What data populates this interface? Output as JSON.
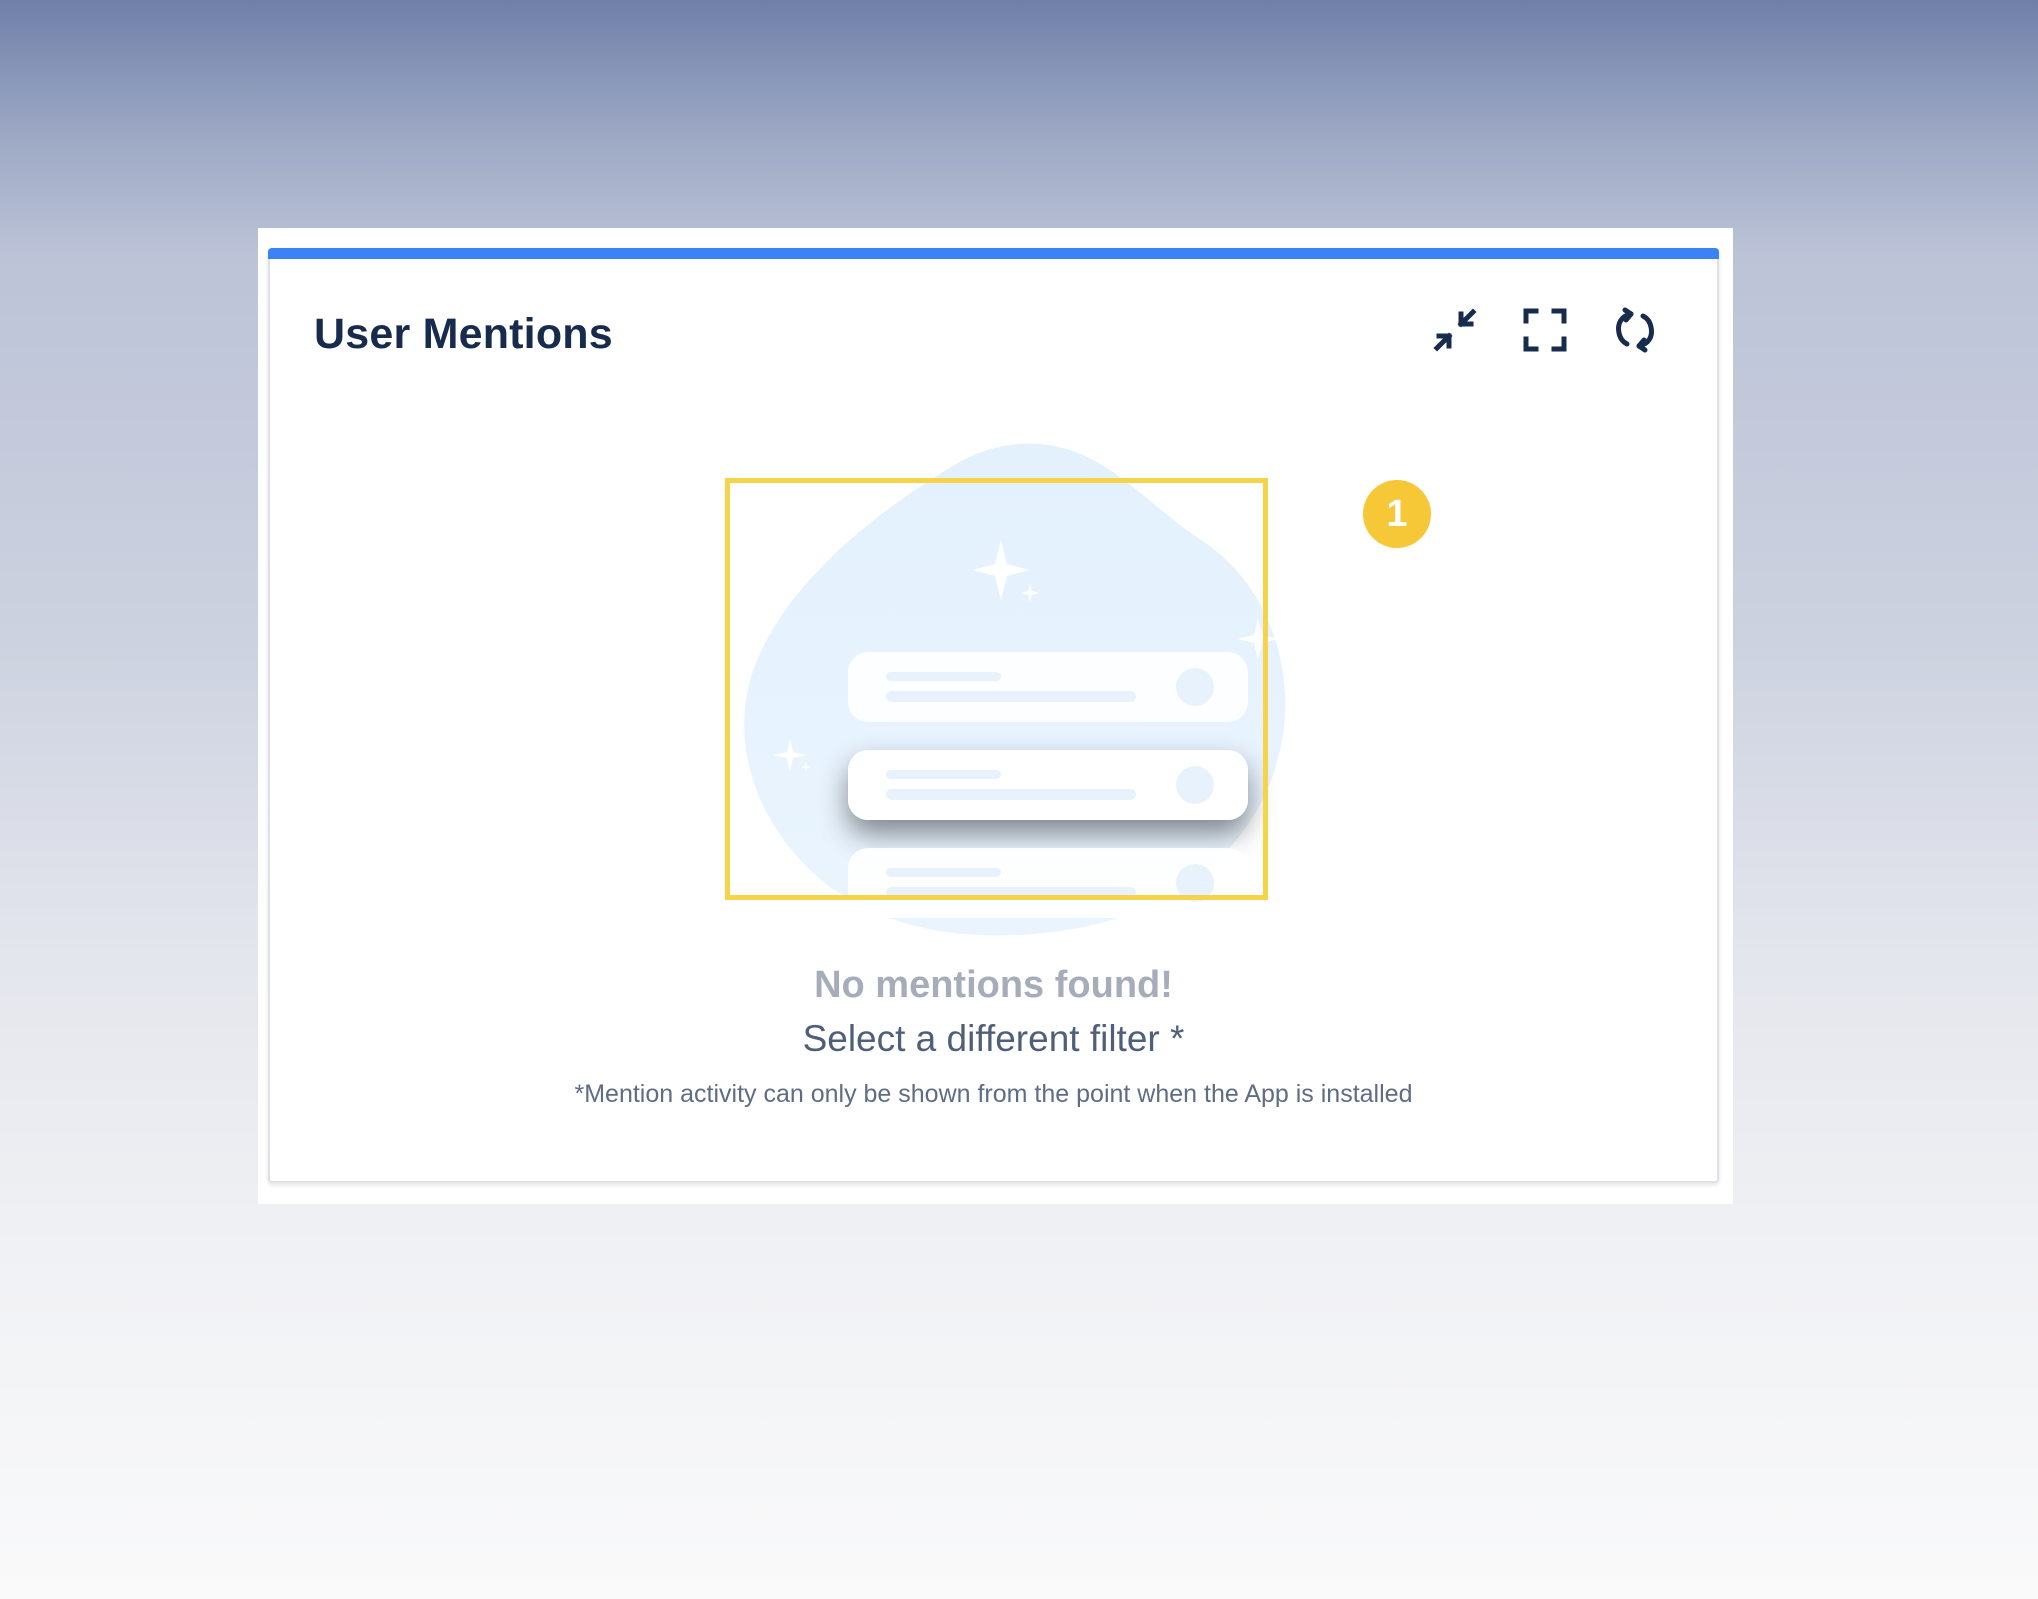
{
  "widget": {
    "title": "User Mentions",
    "accent_color": "#3b82f6"
  },
  "toolbar": {
    "items": [
      {
        "name": "minimize",
        "icon": "minimize-arrows-icon"
      },
      {
        "name": "fullscreen",
        "icon": "fullscreen-corners-icon"
      },
      {
        "name": "refresh",
        "icon": "refresh-icon"
      }
    ]
  },
  "annotation": {
    "badge_number": "1",
    "badge_color": "#f6c736",
    "highlight_color": "#f5d34a"
  },
  "empty_state": {
    "title": "No mentions found!",
    "subtitle": "Select a different filter *",
    "note": "*Mention activity can only be shown from the point when the App is installed"
  }
}
